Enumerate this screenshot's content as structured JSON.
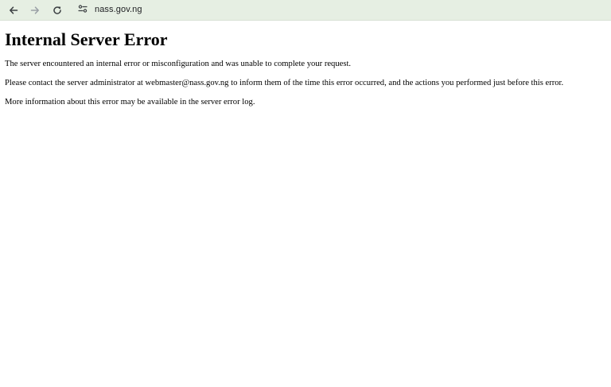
{
  "browser": {
    "url": "nass.gov.ng",
    "icons": {
      "back": "arrow-left-icon",
      "forward": "arrow-right-icon",
      "reload": "reload-icon",
      "site_info": "tune-icon"
    },
    "colors": {
      "toolbar_bg": "#e6efe3"
    }
  },
  "page": {
    "heading": "Internal Server Error",
    "paragraph_1": "The server encountered an internal error or misconfiguration and was unable to complete your request.",
    "paragraph_2": "Please contact the server administrator at webmaster@nass.gov.ng to inform them of the time this error occurred, and the actions you performed just before this error.",
    "paragraph_3": "More information about this error may be available in the server error log."
  }
}
